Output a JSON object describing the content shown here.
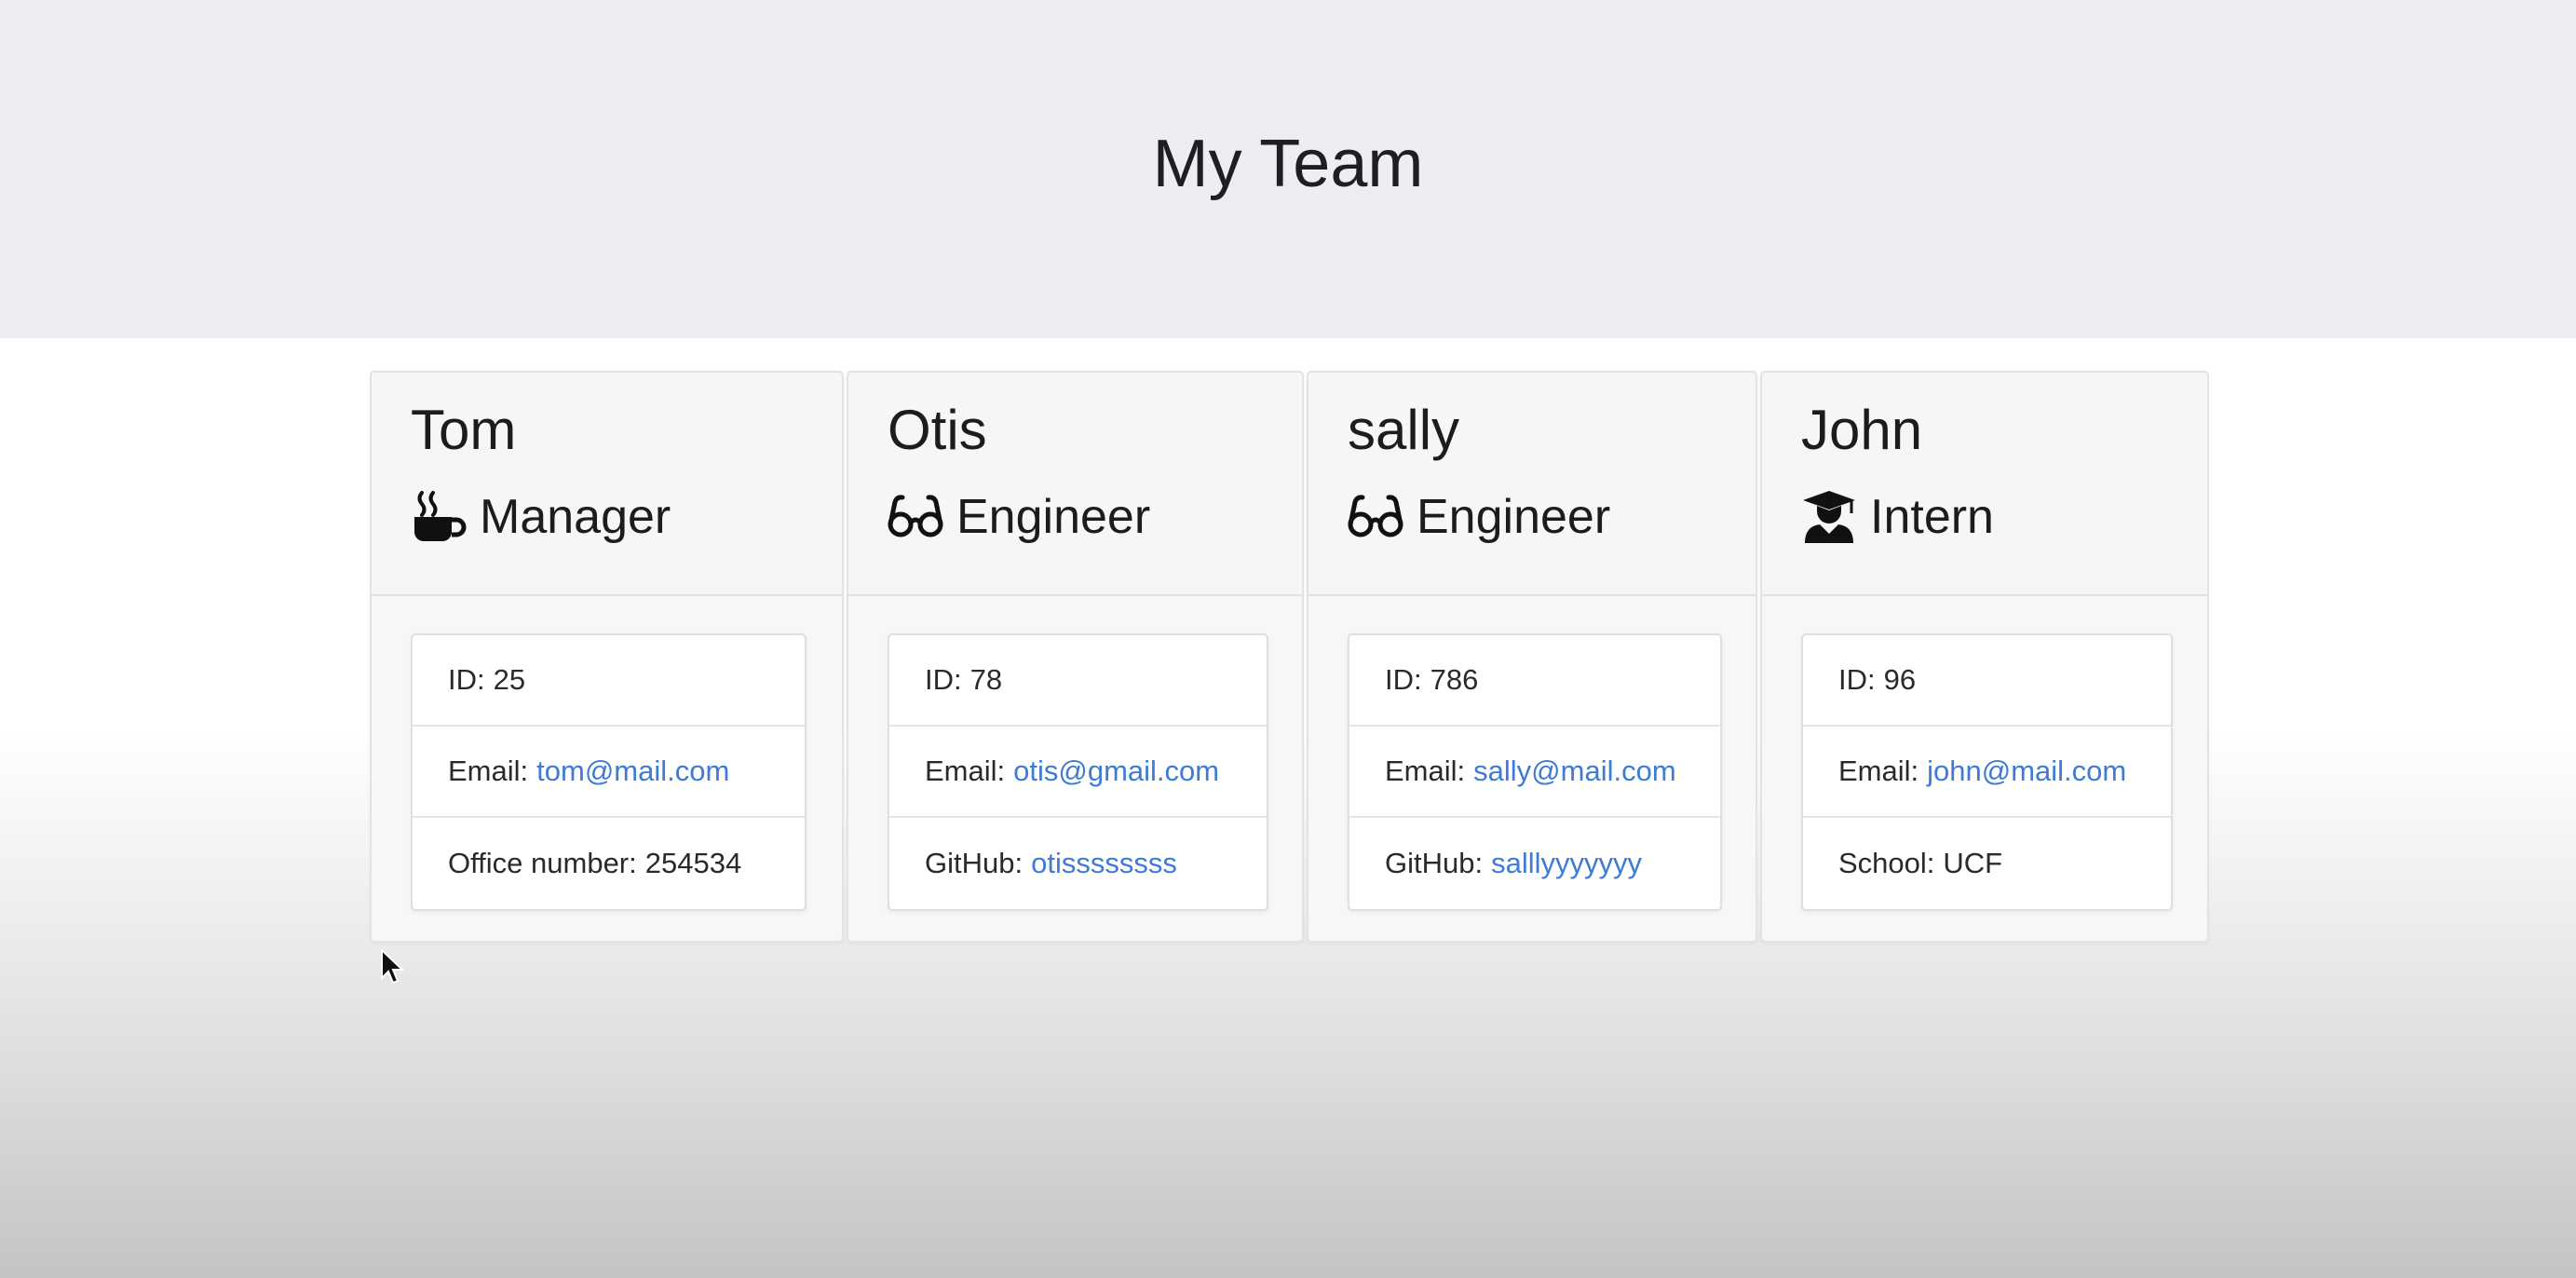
{
  "header": {
    "title": "My Team"
  },
  "team": [
    {
      "name": "Tom",
      "role": "Manager",
      "role_icon": "coffee-mug-icon",
      "id_label": "ID:",
      "id": "25",
      "email_label": "Email:",
      "email": "tom@mail.com",
      "extra_label": "Office number:",
      "extra_value": "254534"
    },
    {
      "name": "Otis",
      "role": "Engineer",
      "role_icon": "glasses-icon",
      "id_label": "ID:",
      "id": "78",
      "email_label": "Email:",
      "email": "otis@gmail.com",
      "extra_label": "GitHub:",
      "extra_value": "otissssssss"
    },
    {
      "name": "sally",
      "role": "Engineer",
      "role_icon": "glasses-icon",
      "id_label": "ID:",
      "id": "786",
      "email_label": "Email:",
      "email": "sally@mail.com",
      "extra_label": "GitHub:",
      "extra_value": "salllyyyyyyy"
    },
    {
      "name": "John",
      "role": "Intern",
      "role_icon": "graduate-icon",
      "id_label": "ID:",
      "id": "96",
      "email_label": "Email:",
      "email": "john@mail.com",
      "extra_label": "School:",
      "extra_value": "UCF"
    }
  ],
  "colors": {
    "link": "#3d7bd6",
    "jumbotron_bg": "#eceef1",
    "card_bg": "#f7f7f7"
  }
}
